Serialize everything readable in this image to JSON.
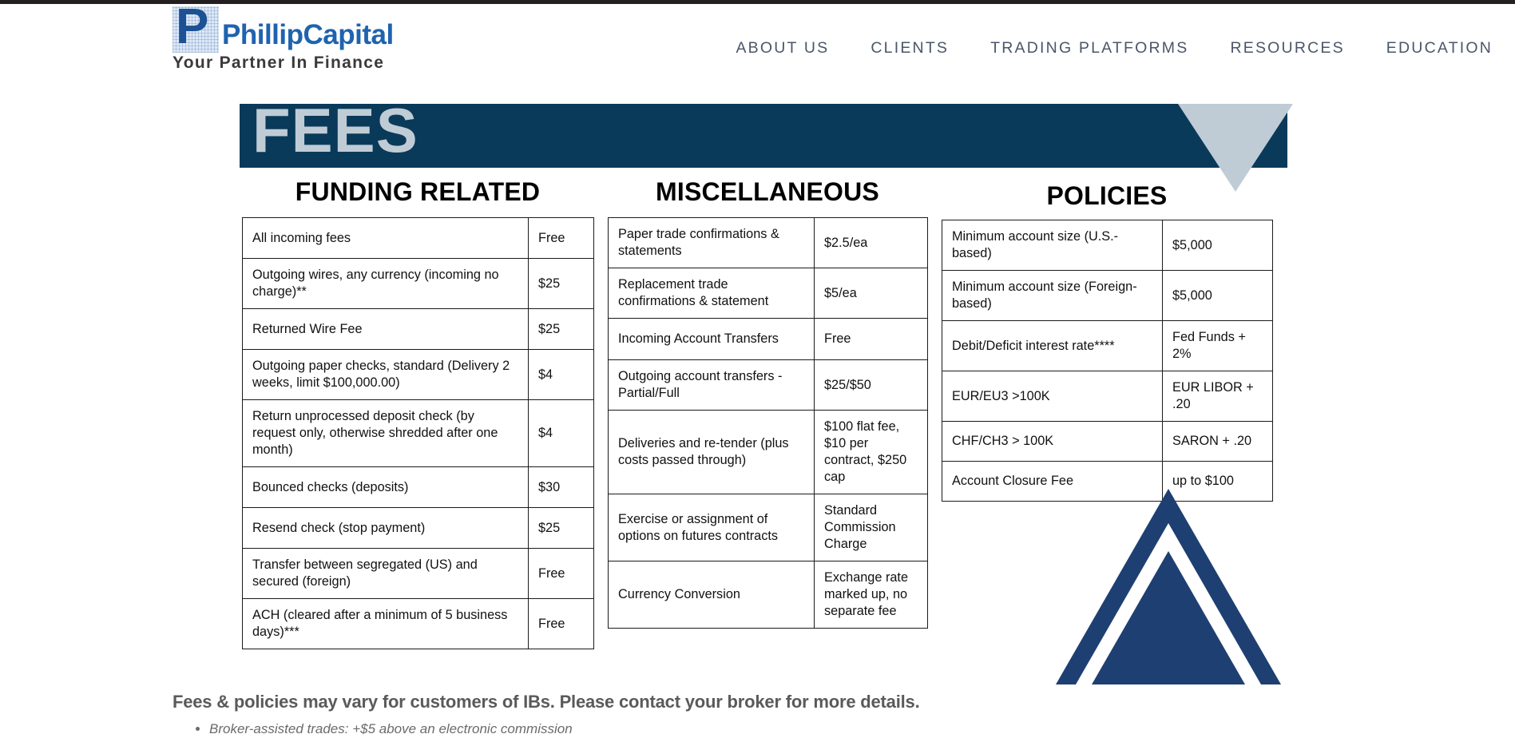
{
  "header": {
    "logo": {
      "mark_letter": "P",
      "wordmark": "PhillipCapital",
      "tagline": "Your Partner In Finance"
    },
    "nav": [
      {
        "label": "ABOUT US"
      },
      {
        "label": "CLIENTS"
      },
      {
        "label": "TRADING PLATFORMS"
      },
      {
        "label": "RESOURCES"
      },
      {
        "label": "EDUCATION"
      }
    ]
  },
  "banner": {
    "title": "FEES",
    "bg_color": "#0a3a5a",
    "text_color": "#bfccd6"
  },
  "columns": [
    {
      "title": "FUNDING RELATED",
      "rows": [
        {
          "label": "All incoming fees",
          "value": "Free"
        },
        {
          "label": "Outgoing wires, any currency (incoming no charge)**",
          "value": "$25"
        },
        {
          "label": "Returned Wire Fee",
          "value": "$25"
        },
        {
          "label": "Outgoing paper checks, standard (Delivery 2 weeks, limit $100,000.00)",
          "value": "$4"
        },
        {
          "label": "Return unprocessed deposit check (by request only, otherwise shredded after one month)",
          "value": "$4"
        },
        {
          "label": "Bounced checks (deposits)",
          "value": "$30"
        },
        {
          "label": "Resend check (stop payment)",
          "value": "$25"
        },
        {
          "label": "Transfer between segregated (US) and secured (foreign)",
          "value": "Free"
        },
        {
          "label": "ACH (cleared after a minimum of 5 business days)***",
          "value": "Free"
        }
      ]
    },
    {
      "title": "MISCELLANEOUS",
      "rows": [
        {
          "label": "Paper trade confirmations & statements",
          "value": "$2.5/ea"
        },
        {
          "label": "Replacement trade confirmations & statement",
          "value": "$5/ea"
        },
        {
          "label": "Incoming Account Transfers",
          "value": "Free"
        },
        {
          "label": "Outgoing account transfers - Partial/Full",
          "value": "$25/$50"
        },
        {
          "label": "Deliveries and re-tender (plus costs passed through)",
          "value": "$100 flat fee, $10 per contract, $250 cap"
        },
        {
          "label": "Exercise or assignment of options on futures contracts",
          "value": "Standard Commission Charge"
        },
        {
          "label": "Currency Conversion",
          "value": "Exchange rate marked up, no separate fee"
        }
      ]
    },
    {
      "title": "POLICIES",
      "rows": [
        {
          "label": "Minimum account size (U.S.-based)",
          "value": "$5,000"
        },
        {
          "label": "Minimum account size (Foreign-based)",
          "value": "$5,000"
        },
        {
          "label": "Debit/Deficit interest rate****",
          "value": "Fed Funds + 2%"
        },
        {
          "label": "EUR/EU3 >100K",
          "value": "EUR LIBOR + .20"
        },
        {
          "label": "CHF/CH3 > 100K",
          "value": "SARON + .20"
        },
        {
          "label": "Account Closure Fee",
          "value": "up to $100"
        }
      ]
    }
  ],
  "footer": {
    "headline": "Fees & policies may vary for customers of IBs. Please contact your broker for more details.",
    "bullets": [
      "Broker-assisted trades: +$5 above an electronic commission"
    ]
  },
  "decor": {
    "triangle_logo_color": "#1e3f71"
  }
}
